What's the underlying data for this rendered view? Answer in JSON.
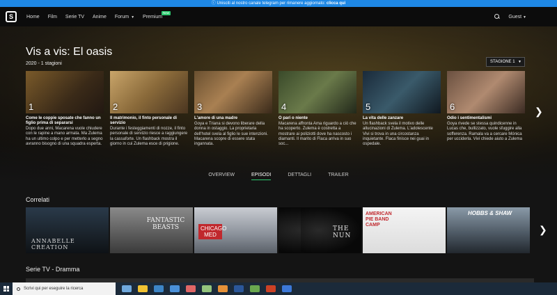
{
  "banner": {
    "text": "Unisciti al nostro canale telegram per rimanere aggiornato:",
    "link": "clicca qui"
  },
  "navbar": {
    "items": [
      "Home",
      "Film",
      "Serie TV",
      "Anime",
      "Forum",
      "Premium"
    ],
    "premium_badge": "New",
    "guest": "Guest"
  },
  "show": {
    "title": "Vis a vis: El oasis",
    "meta": "2020 - 1 stagioni",
    "season_select": "STAGIONE 1"
  },
  "episodes": [
    {
      "num": "1",
      "title": "Come le coppie sposate che fanno un figlio prima di separarsi",
      "desc": "Dopo due anni, Macarena vuole chiudere con le rapine a mano armata. Ma Zulema ha un ultimo colpo e per metterlo a segno avranno bisogno di una squadra esperta."
    },
    {
      "num": "2",
      "title": "Il matrimonio, il finto personale di servizio",
      "desc": "Durante i festeggiamenti di nozze, il finto personale di servizio riesce a raggiungere la cassaforte. Un flashback mostra il giorno in cui Zulema esce di prigione."
    },
    {
      "num": "3",
      "title": "L'amore di una madre",
      "desc": "Goya e Triana si devono liberare della donna in ostaggio. La proprietaria dell'hotel svela al figlio le sue intenzioni. Macarena scopre di essere stata ingannata."
    },
    {
      "num": "4",
      "title": "O pari o niente",
      "desc": "Macarena affronta Ama riguardo a ciò che ha scoperto. Zulema è costretta a mostrare ai poliziotti dove ha nascosto i diamanti. Il marito di Flaca arriva in suo soc..."
    },
    {
      "num": "5",
      "title": "La vita delle zanzare",
      "desc": "Un flashback svela il motivo delle allucinazioni di Zulema. L'adolescente Vivi si trova in una circostanza inquietante. Flaca finisce nei guai in ospedale."
    },
    {
      "num": "6",
      "title": "Odio i sentimentalismi",
      "desc": "Goya rivede se stessa quindicenne in Lucas che, bullizzato, vuole sfuggire alla sofferenza. Ramala va a cercare Mónica per ucciderla. Vivi chiede aiuto a Zulema"
    }
  ],
  "tabs": [
    "OVERVIEW",
    "EPISODI",
    "DETTAGLI",
    "TRAILER"
  ],
  "active_tab": "EPISODI",
  "sections": {
    "related": "Correlati",
    "drama": "Serie TV - Dramma"
  },
  "related": [
    "ANNABELLE CREATION",
    "FANTASTIC BEASTS",
    "CHICAGO MED",
    "",
    "THE NUN",
    "AMERICAN PIE BAND CAMP",
    "HOBBS & SHAW"
  ],
  "taskbar": {
    "search_placeholder": "Scrivi qui per eseguire la ricerca"
  },
  "colors": {
    "accent": "#2ecc71",
    "banner": "#1e88e5",
    "background": "#141414"
  }
}
